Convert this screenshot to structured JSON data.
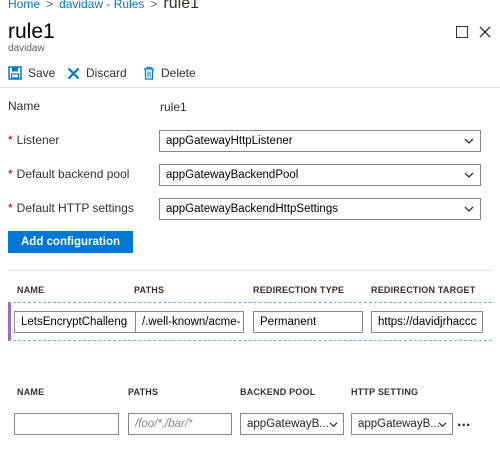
{
  "breadcrumb": {
    "items": [
      "Home",
      "davidaw - Rules",
      "rule1"
    ],
    "separator": ">"
  },
  "blade": {
    "title": "rule1",
    "subtitle": "davidaw"
  },
  "toolbar": {
    "save_label": "Save",
    "discard_label": "Discard",
    "delete_label": "Delete"
  },
  "form": {
    "name_label": "Name",
    "name_value": "rule1",
    "required_mark": "*",
    "listener_label": "Listener",
    "listener_value": "appGatewayHttpListener",
    "backend_pool_label": "Default backend pool",
    "backend_pool_value": "appGatewayBackendPool",
    "http_settings_label": "Default HTTP settings",
    "http_settings_value": "appGatewayBackendHttpSettings",
    "add_config_label": "Add configuration"
  },
  "redirect_table": {
    "headers": [
      "NAME",
      "PATHS",
      "REDIRECTION TYPE",
      "REDIRECTION TARGET"
    ],
    "row": {
      "name": "LetsEncryptChalleng",
      "paths": "/.well-known/acme-",
      "type": "Permanent",
      "target": "https://davidjrhaccc"
    }
  },
  "path_table": {
    "headers": [
      "NAME",
      "PATHS",
      "BACKEND POOL",
      "HTTP SETTING"
    ],
    "new_row": {
      "name": "",
      "paths_placeholder": "/foo/*,/bar/*",
      "backend_pool": "appGatewayB...",
      "http_setting": "appGatewayB..."
    },
    "more_label": "..."
  },
  "colors": {
    "accent": "#0078d4",
    "required": "#a80000",
    "row_marker": "#a36ac4"
  },
  "icons": [
    "save-icon",
    "discard-icon",
    "delete-icon",
    "maximize-icon",
    "close-icon",
    "chevron-down-icon"
  ]
}
